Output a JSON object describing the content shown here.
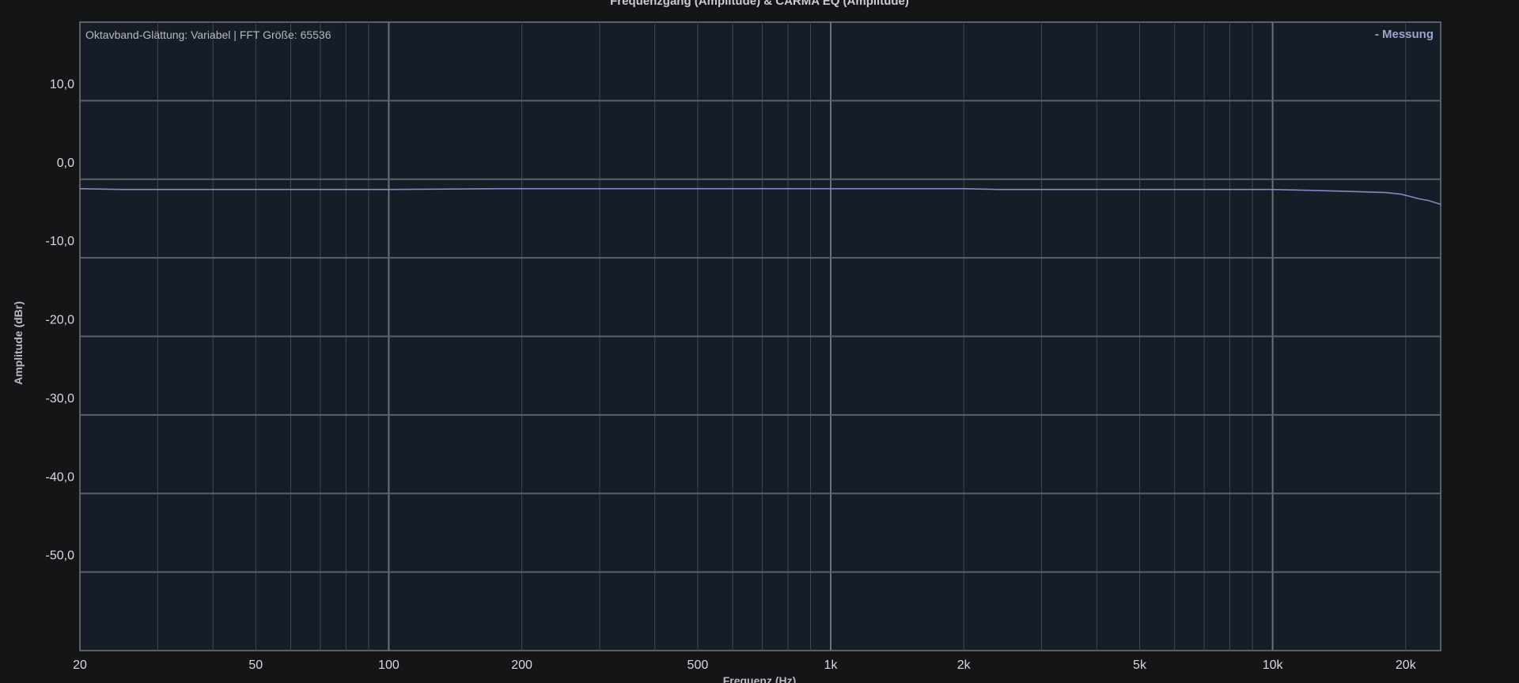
{
  "chart_data": {
    "type": "line",
    "title": "Frequenzgang (Amplitude) & CARMA EQ (Amplitude)",
    "xlabel": "Frequenz (Hz)",
    "ylabel": "Amplitude (dBr)",
    "x_scale": "log",
    "xlim": [
      20,
      24000
    ],
    "ylim": [
      -60,
      20
    ],
    "x_ticks": [
      {
        "value": 20,
        "label": "20"
      },
      {
        "value": 50,
        "label": "50"
      },
      {
        "value": 100,
        "label": "100"
      },
      {
        "value": 200,
        "label": "200"
      },
      {
        "value": 500,
        "label": "500"
      },
      {
        "value": 1000,
        "label": "1k"
      },
      {
        "value": 2000,
        "label": "2k"
      },
      {
        "value": 5000,
        "label": "5k"
      },
      {
        "value": 10000,
        "label": "10k"
      },
      {
        "value": 20000,
        "label": "20k"
      }
    ],
    "y_ticks": [
      {
        "value": 10,
        "label": "10,0"
      },
      {
        "value": 0,
        "label": "0,0"
      },
      {
        "value": -10,
        "label": "-10,0"
      },
      {
        "value": -20,
        "label": "-20,0"
      },
      {
        "value": -30,
        "label": "-30,0"
      },
      {
        "value": -40,
        "label": "-40,0"
      },
      {
        "value": -50,
        "label": "-50,0"
      }
    ],
    "grid": true,
    "legend_position": "top-right",
    "annotation": "Oktavband-Glättung: Variabel | FFT Größe: 65536",
    "series": [
      {
        "name": "Messung",
        "legend_label": "- Messung",
        "color": "#7f8bc0",
        "x": [
          20,
          25,
          50,
          100,
          180,
          500,
          1000,
          2000,
          2400,
          5000,
          10000,
          12000,
          14000,
          16000,
          18000,
          19500,
          20500,
          21500,
          22500,
          24000
        ],
        "y": [
          -1.2,
          -1.3,
          -1.3,
          -1.3,
          -1.2,
          -1.2,
          -1.2,
          -1.2,
          -1.3,
          -1.3,
          -1.3,
          -1.4,
          -1.5,
          -1.6,
          -1.7,
          -1.9,
          -2.2,
          -2.5,
          -2.7,
          -3.2
        ]
      }
    ]
  }
}
